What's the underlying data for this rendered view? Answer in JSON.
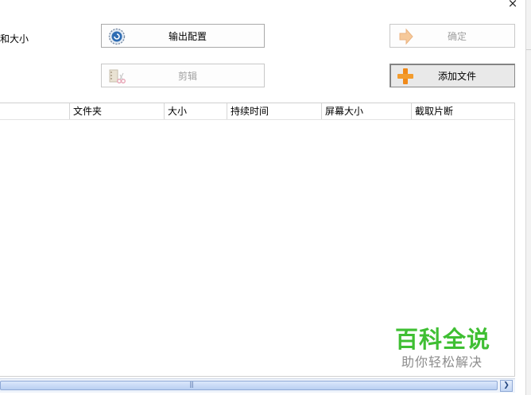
{
  "window": {
    "close_glyph": "×"
  },
  "labels": {
    "size_label": "和大小"
  },
  "buttons": {
    "output_config": {
      "label": "输出配置",
      "icon": "gear-globe-icon"
    },
    "confirm": {
      "label": "确定",
      "icon": "arrow-right-icon",
      "state": "disabled"
    },
    "edit": {
      "label": "剪辑",
      "icon": "film-scissors-icon",
      "state": "disabled"
    },
    "add_file": {
      "label": "添加文件",
      "icon": "plus-icon",
      "state": "pressed"
    }
  },
  "table": {
    "columns": [
      "文件夹",
      "大小",
      "持续时间",
      "屏幕大小",
      "截取片断"
    ],
    "rows": []
  },
  "scrollbar": {
    "grip": "|||",
    "right_arrow": "❯"
  },
  "watermark": {
    "title": "百科全说",
    "subtitle": "助你轻松解决"
  },
  "colors": {
    "watermark_green": "#3fbf33",
    "scroll_blue": "#b9cff2",
    "plus_orange": "#f08a1a"
  }
}
